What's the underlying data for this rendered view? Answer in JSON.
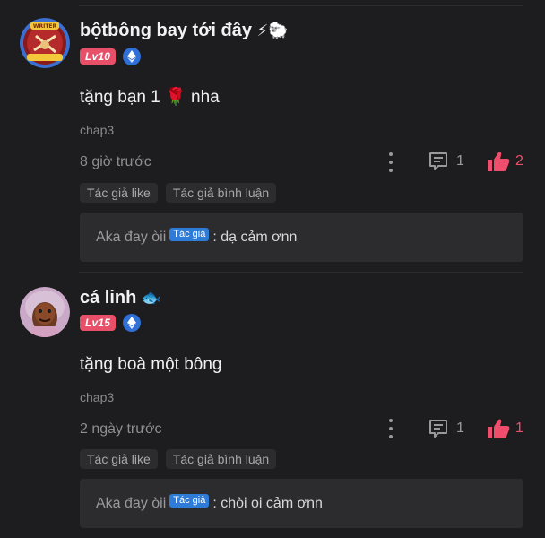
{
  "comments": [
    {
      "username": "bộtbông bay tới đây",
      "name_emojis": "⚡🐑",
      "level": "Lv10",
      "avatar_text": "WRITER",
      "text": "tặng bạn 1",
      "text_emoji": "🌹",
      "text_suffix": "nha",
      "chapter": "chap3",
      "time": "8 giờ trước",
      "reply_count": "1",
      "like_count": "2",
      "tags": [
        "Tác giả like",
        "Tác giả bình luận"
      ],
      "reply": {
        "author": "Aka đay òii",
        "author_badge": "Tác giả",
        "text": ": dạ cảm ơnn"
      }
    },
    {
      "username": "cá linh",
      "name_emojis": "🐟",
      "level": "Lv15",
      "text": "tặng boà một bông",
      "text_emoji": "",
      "text_suffix": "",
      "chapter": "chap3",
      "time": "2 ngày trước",
      "reply_count": "1",
      "like_count": "1",
      "tags": [
        "Tác giả like",
        "Tác giả bình luận"
      ],
      "reply": {
        "author": "Aka đay òii",
        "author_badge": "Tác giả",
        "text": ": chòi oi cảm ơnn"
      }
    }
  ],
  "colors": {
    "background": "#1d1d1f",
    "like": "#ee4d6b",
    "level_badge": "#e8506a",
    "author_badge": "#2f7bd8"
  },
  "icons": [
    "more-vertical-icon",
    "comment-icon",
    "thumbs-up-icon",
    "ethereum-icon"
  ]
}
